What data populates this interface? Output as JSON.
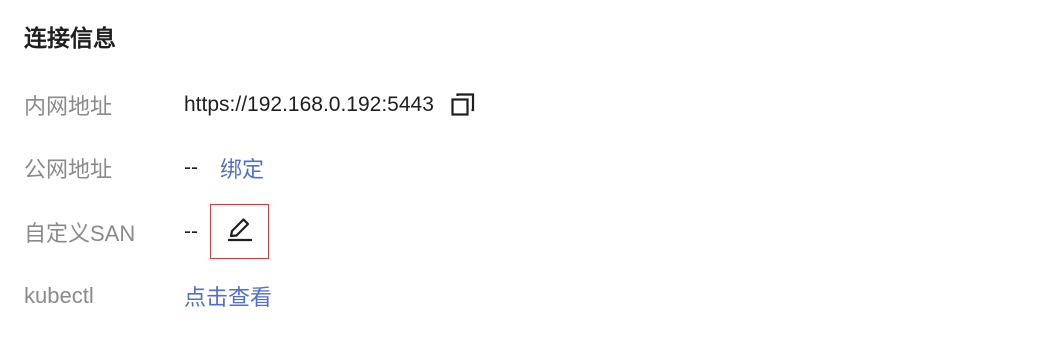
{
  "section": {
    "title": "连接信息"
  },
  "rows": [
    {
      "label": "内网地址",
      "value": "https://192.168.0.192:5443",
      "icon": "copy-icon"
    },
    {
      "label": "公网地址",
      "value": "--",
      "action": "绑定"
    },
    {
      "label": "自定义SAN",
      "value": "--",
      "icon": "edit-icon"
    },
    {
      "label": "kubectl",
      "action": "点击查看"
    }
  ],
  "colors": {
    "label": "#8a8a8a",
    "text": "#1f1f1f",
    "link": "#526ecc",
    "highlight_border": "#e0353b"
  }
}
